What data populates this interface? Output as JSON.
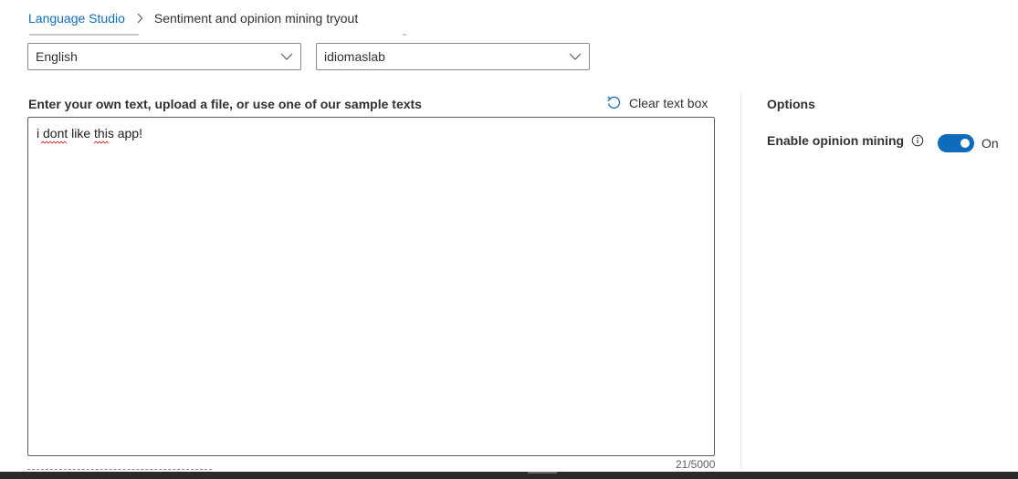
{
  "breadcrumb": {
    "root": "Language Studio",
    "current": "Sentiment and opinion mining tryout"
  },
  "language_select": {
    "value": "English"
  },
  "resource_select": {
    "value": "idiomaslab"
  },
  "input": {
    "label": "Enter your own text, upload a file, or use one of our sample texts",
    "clear_label": "Clear text box",
    "text": "i dont like this app!",
    "counter": "21/5000"
  },
  "options": {
    "title": "Options",
    "opinion_mining_label": "Enable opinion mining",
    "toggle_state": "On",
    "toggle_on": true
  },
  "colors": {
    "accent": "#0f6cbd",
    "link": "#0f6cbd",
    "text": "#323130",
    "spellcheck": "#d13438"
  },
  "icons": {
    "breadcrumb_separator": "chevron-right-icon",
    "dropdown": "chevron-down-icon",
    "clear": "undo-icon",
    "info": "info-icon"
  }
}
